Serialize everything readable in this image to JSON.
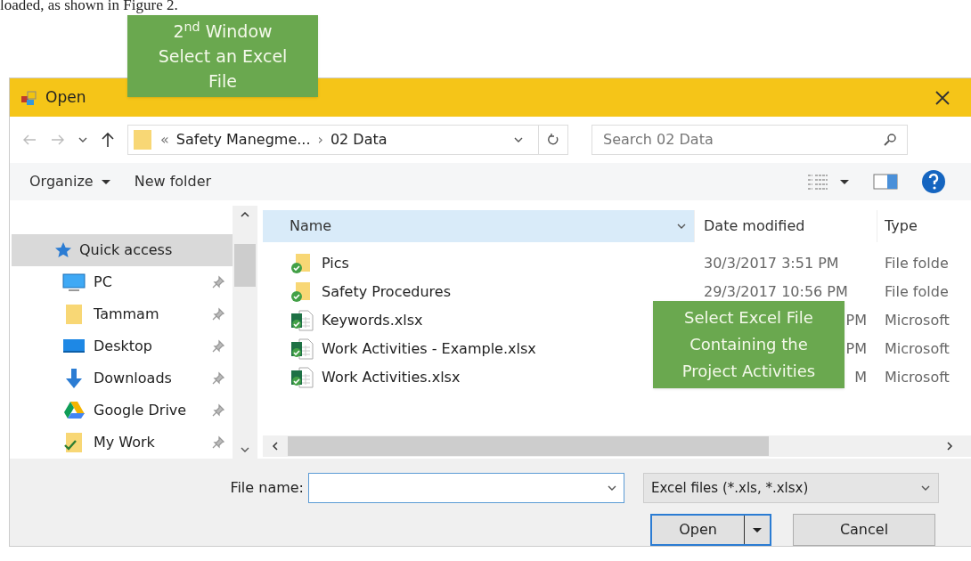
{
  "document_text": "loaded, as shown in Figure 2.",
  "callouts": [
    {
      "lines": [
        "2$^{nd}$  Window",
        "Select an Excel",
        "File"
      ]
    },
    {
      "lines": [
        "Select Excel File",
        "Containing the",
        "Project Activities"
      ]
    }
  ],
  "dialog": {
    "title": "Open",
    "nav": {
      "path": [
        {
          "text": "«",
          "kind": "sep"
        },
        {
          "text": "Safety Manegme...",
          "kind": "seg"
        },
        {
          "text": "›",
          "kind": "sep"
        },
        {
          "text": "02 Data",
          "kind": "seg"
        }
      ],
      "search_placeholder": "Search 02 Data"
    },
    "toolbar": [
      {
        "label": "Organize",
        "menu": true
      },
      {
        "label": "New folder",
        "menu": false
      }
    ],
    "sidebar": [
      {
        "label": "Quick access",
        "kind": "star",
        "selected": true,
        "pinned": false
      },
      {
        "label": "PC",
        "kind": "pc",
        "selected": false,
        "pinned": true
      },
      {
        "label": "Tammam",
        "kind": "folder",
        "selected": false,
        "pinned": true
      },
      {
        "label": "Desktop",
        "kind": "desktop",
        "selected": false,
        "pinned": true
      },
      {
        "label": "Downloads",
        "kind": "downloads",
        "selected": false,
        "pinned": true
      },
      {
        "label": "Google Drive",
        "kind": "drive",
        "selected": false,
        "pinned": true
      },
      {
        "label": "My Work",
        "kind": "work",
        "selected": false,
        "pinned": true
      }
    ],
    "columns": [
      {
        "label": "Name",
        "selected": true
      },
      {
        "label": "Date modified",
        "selected": false
      },
      {
        "label": "Type",
        "selected": false
      }
    ],
    "rows": [
      {
        "name": "Pics",
        "kind": "folder",
        "date": "30/3/2017 3:51 PM",
        "date_covered": false,
        "type": "File folde"
      },
      {
        "name": "Safety Procedures",
        "kind": "folder",
        "date": "29/3/2017 10:56 PM",
        "date_covered": false,
        "type": "File folde"
      },
      {
        "name": "Keywords.xlsx",
        "kind": "excel",
        "date": "PM",
        "date_covered": true,
        "type": "Microsoft"
      },
      {
        "name": "Work Activities - Example.xlsx",
        "kind": "excel",
        "date": "PM",
        "date_covered": true,
        "type": "Microsoft"
      },
      {
        "name": "Work Activities.xlsx",
        "kind": "excel",
        "date": "M",
        "date_covered": true,
        "type": "Microsoft"
      }
    ],
    "file_name_label": "File name:",
    "filter": "Excel files (*.xls, *.xlsx)",
    "buttons": [
      {
        "label": "Open",
        "default": true
      },
      {
        "label": "Cancel",
        "default": false
      }
    ]
  }
}
